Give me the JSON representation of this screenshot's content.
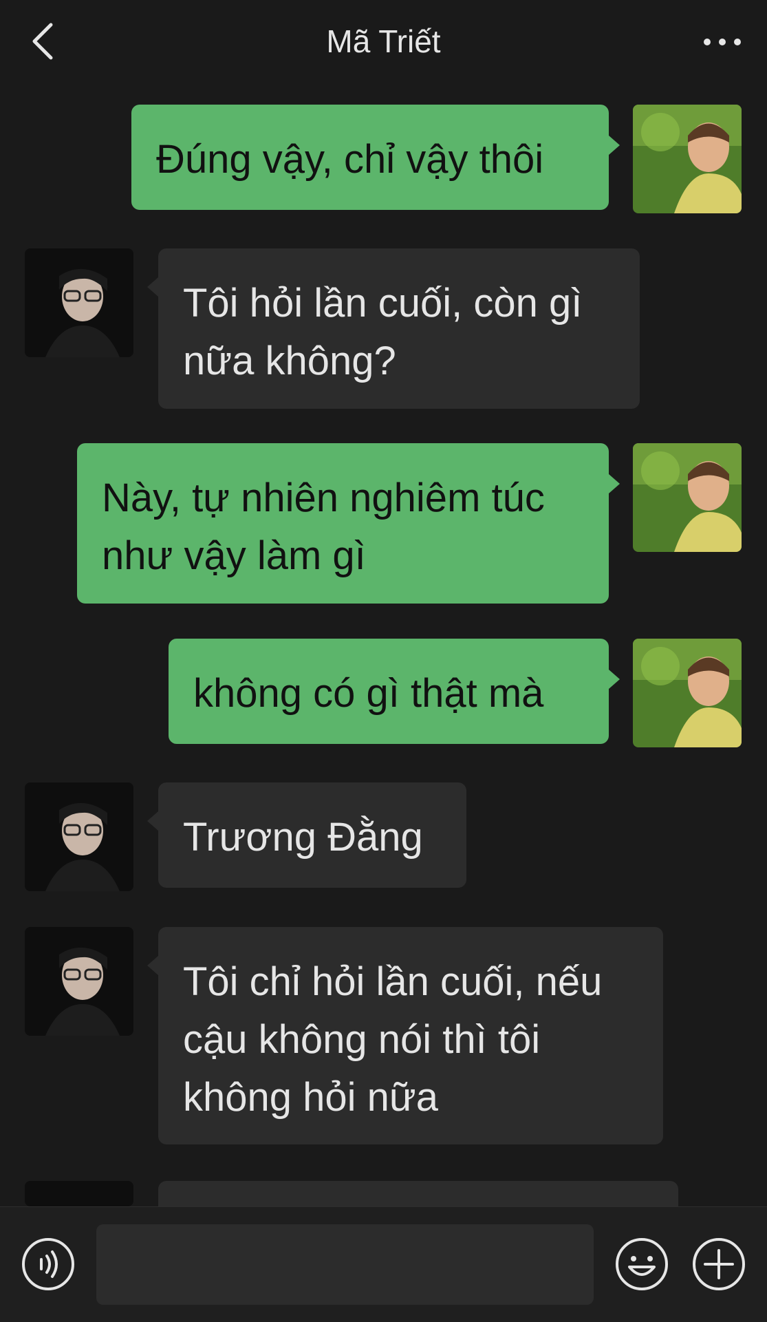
{
  "header": {
    "title": "Mã Triết"
  },
  "messages": [
    {
      "sender": "me",
      "text_lines": [
        "Đúng vậy, chỉ vậy thôi"
      ]
    },
    {
      "sender": "them",
      "text_lines": [
        "Tôi hỏi lần cuối, còn gì",
        "nữa không?"
      ]
    },
    {
      "sender": "me",
      "text_lines": [
        "Này, tự nhiên nghiêm túc",
        "như vậy làm gì"
      ]
    },
    {
      "sender": "me",
      "text_lines": [
        "không có gì thật mà"
      ]
    },
    {
      "sender": "them",
      "text_lines": [
        "Trương Đằng"
      ]
    },
    {
      "sender": "them",
      "text_lines": [
        "Tôi chỉ hỏi lần cuối, nếu",
        "cậu không nói thì tôi",
        "không hỏi nữa"
      ]
    }
  ],
  "icons": {
    "back": "chevron-left-icon",
    "more": "more-dots-icon",
    "voice": "voice-icon",
    "emoji": "emoji-icon",
    "plus": "plus-icon"
  },
  "colors": {
    "background": "#1a1a1a",
    "my_bubble": "#5cb56b",
    "their_bubble": "#2c2c2c"
  }
}
